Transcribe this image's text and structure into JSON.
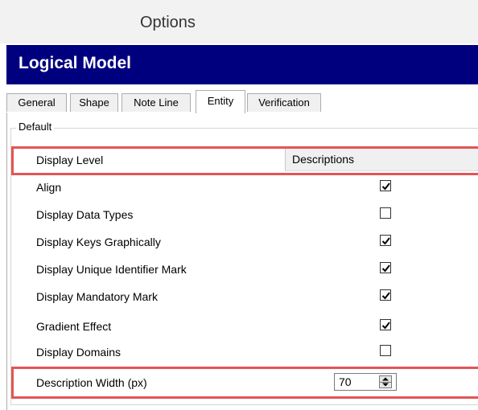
{
  "window": {
    "title": "Options"
  },
  "header": {
    "title": "Logical Model"
  },
  "tabs": [
    {
      "label": "General"
    },
    {
      "label": "Shape"
    },
    {
      "label": "Note Line"
    },
    {
      "label": "Entity",
      "active": true
    },
    {
      "label": "Verification"
    }
  ],
  "group": {
    "label": "Default",
    "display_level": {
      "label": "Display Level",
      "value": "Descriptions"
    },
    "checkboxes": [
      {
        "label": "Align",
        "checked": true
      },
      {
        "label": "Display Data Types",
        "checked": false
      },
      {
        "label": "Display Keys Graphically",
        "checked": true
      },
      {
        "label": "Display Unique Identifier Mark",
        "checked": true
      },
      {
        "label": "Display Mandatory Mark",
        "checked": true
      },
      {
        "label": "Gradient Effect",
        "checked": true
      },
      {
        "label": "Display Domains",
        "checked": false
      }
    ],
    "description_width": {
      "label": "Description Width (px)",
      "value": "70"
    }
  },
  "colors": {
    "header_bg": "#00007f",
    "highlight_border": "#e35555",
    "titlebar_bg": "#f2f2f2"
  }
}
